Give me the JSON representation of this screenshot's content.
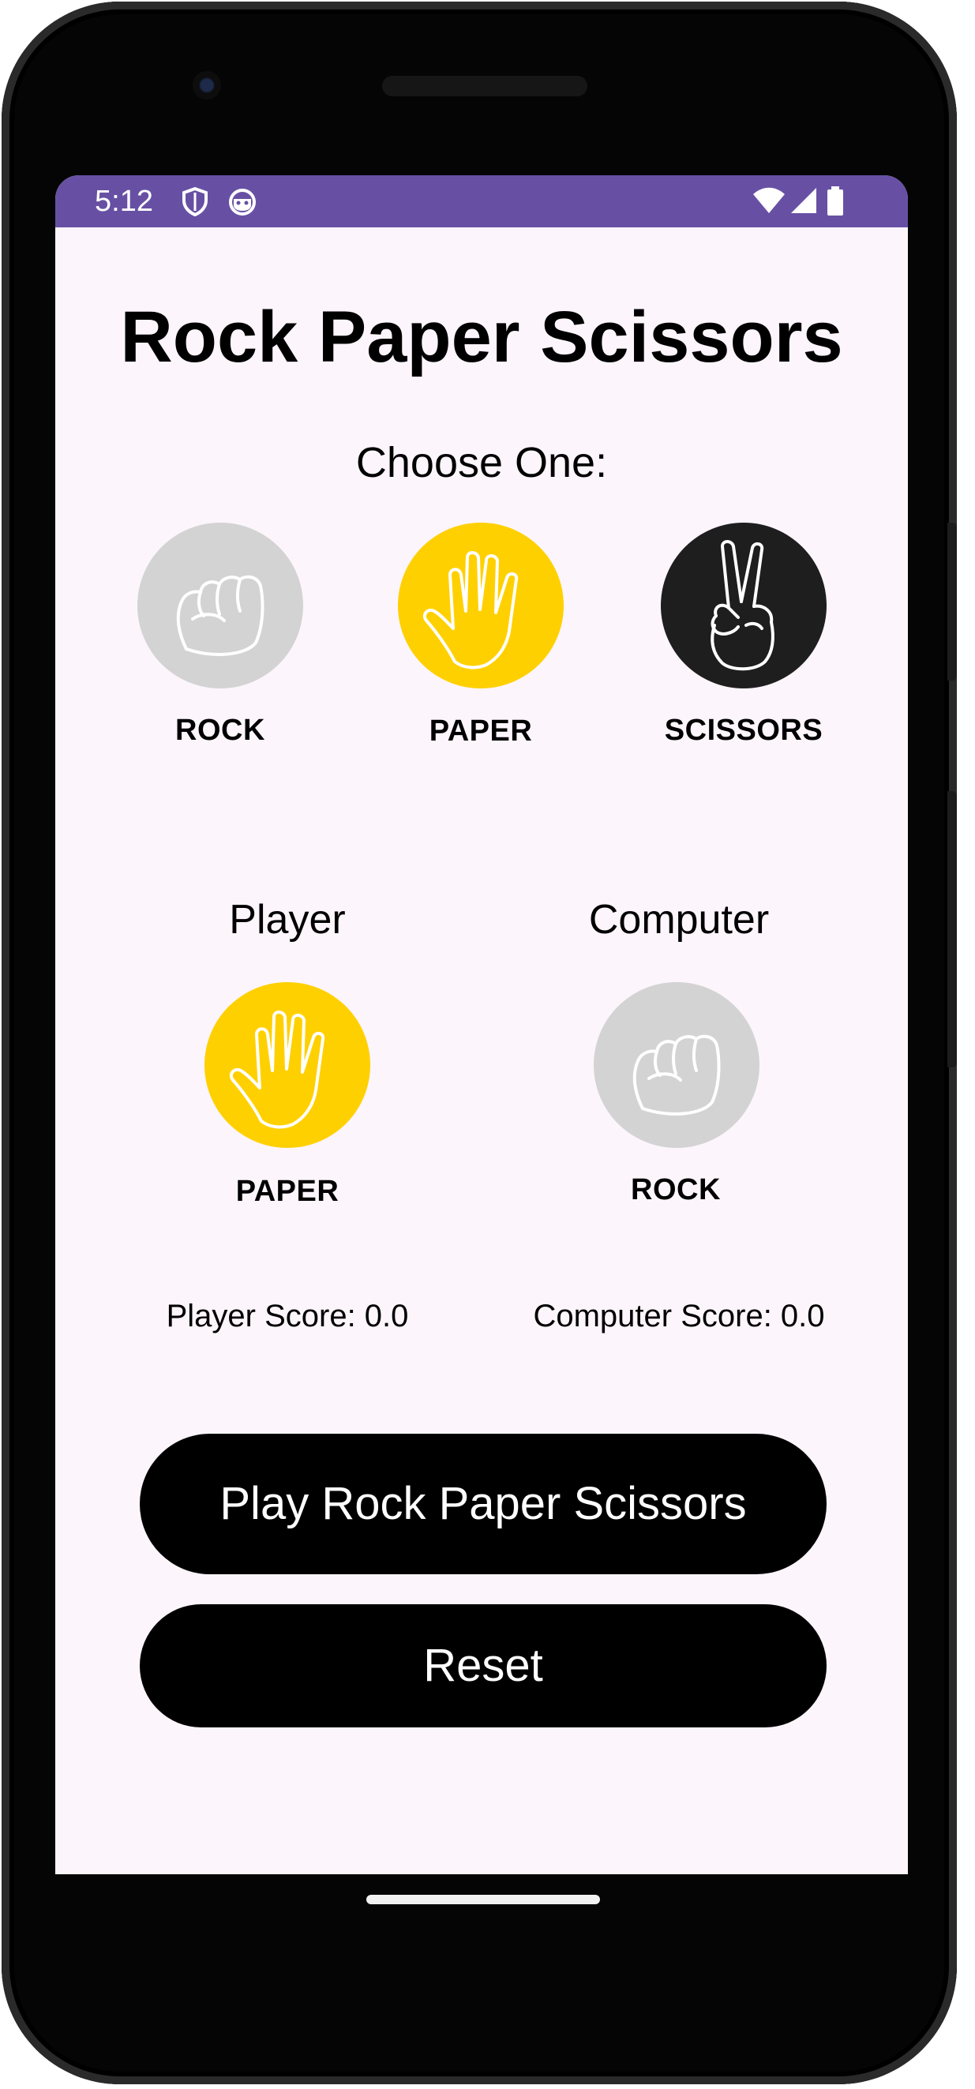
{
  "status_bar": {
    "time": "5:12"
  },
  "app": {
    "title": "Rock Paper Scissors",
    "choose_prompt": "Choose One:"
  },
  "choices": [
    {
      "label": "ROCK",
      "icon": "rock-fist-icon",
      "color": "#d3d3d3"
    },
    {
      "label": "PAPER",
      "icon": "paper-hand-icon",
      "color": "#ffd000"
    },
    {
      "label": "SCISSORS",
      "icon": "scissors-peace-icon",
      "color": "#1e1e1e"
    }
  ],
  "player": {
    "title": "Player",
    "choice_label": "PAPER",
    "score_text": "Player Score: 0.0"
  },
  "computer": {
    "title": "Computer",
    "choice_label": "ROCK",
    "score_text": "Computer Score: 0.0"
  },
  "buttons": {
    "play_label": "Play Rock Paper Scissors",
    "reset_label": "Reset"
  },
  "colors": {
    "status_bar": "#6750a4",
    "screen_background": "#fcf5fb",
    "paper_yellow": "#ffd000",
    "rock_grey": "#d3d3d3",
    "scissors_dark": "#1e1e1e",
    "button_black": "#000000"
  }
}
